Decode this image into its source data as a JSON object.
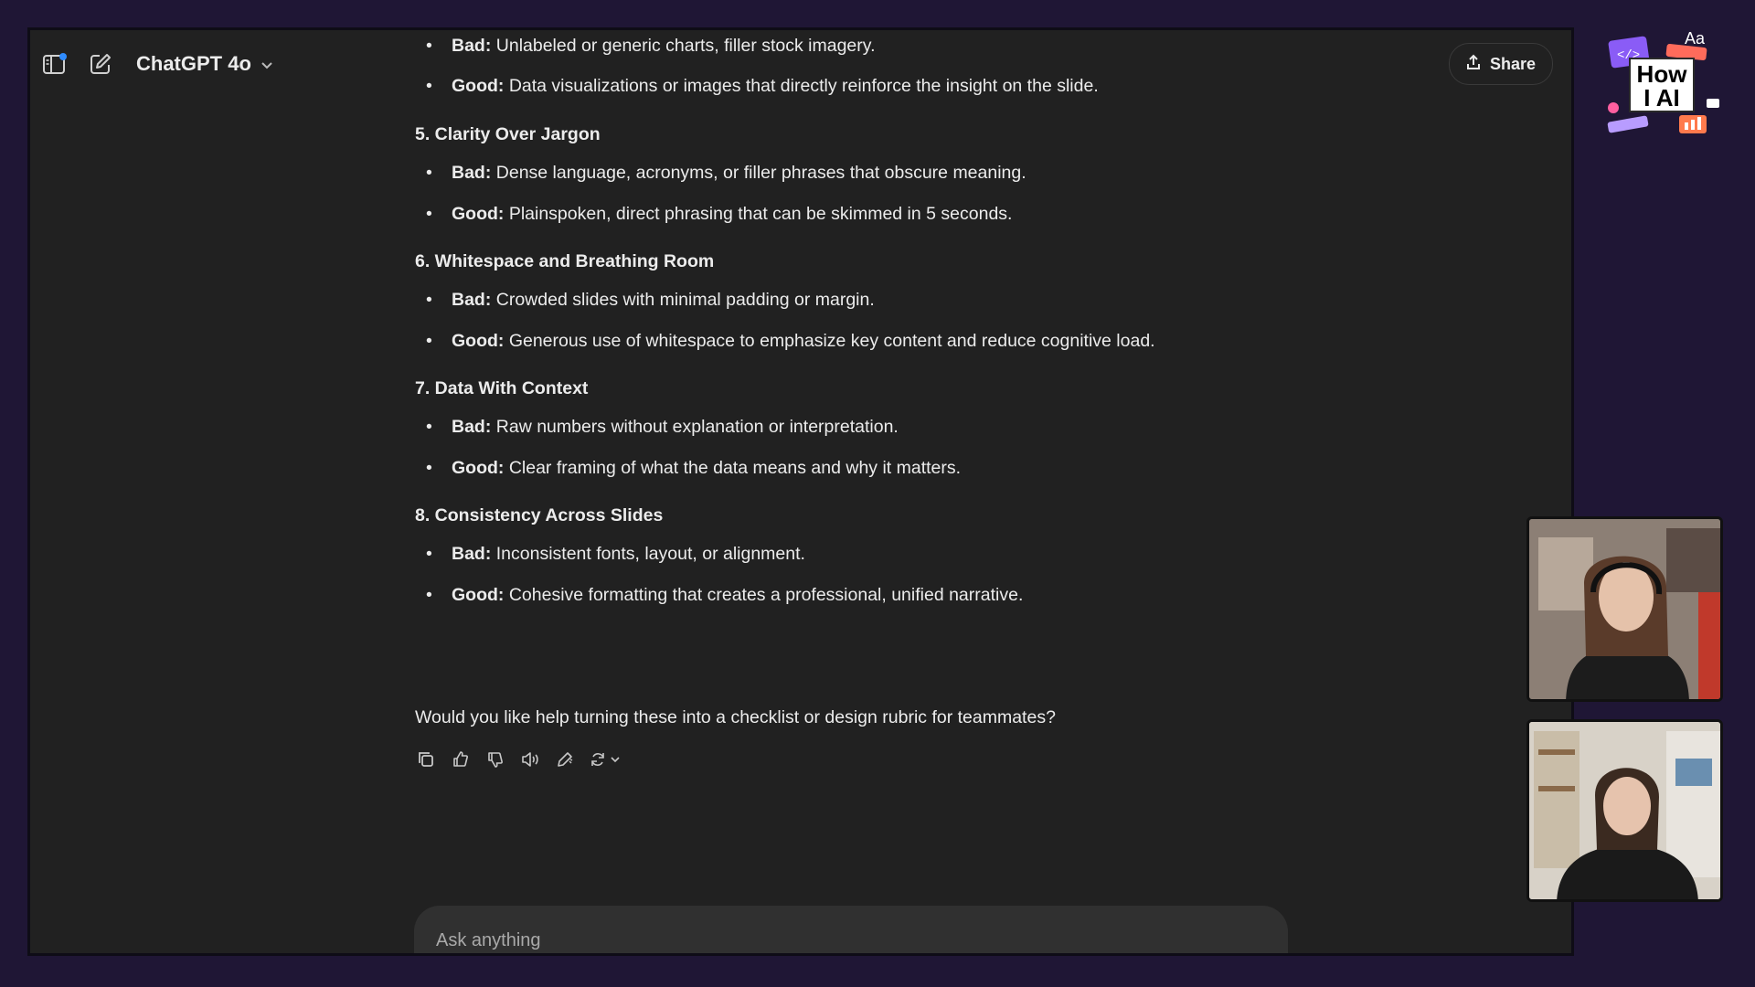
{
  "header": {
    "model_label": "ChatGPT 4o",
    "share_label": "Share"
  },
  "sections": [
    {
      "title": "",
      "items": [
        {
          "label": "Bad:",
          "text": " Unlabeled or generic charts, filler stock imagery."
        },
        {
          "label": "Good:",
          "text": " Data visualizations or images that directly reinforce the insight on the slide."
        }
      ]
    },
    {
      "title": "5. Clarity Over Jargon",
      "items": [
        {
          "label": "Bad:",
          "text": " Dense language, acronyms, or filler phrases that obscure meaning."
        },
        {
          "label": "Good:",
          "text": " Plainspoken, direct phrasing that can be skimmed in 5 seconds."
        }
      ]
    },
    {
      "title": "6. Whitespace and Breathing Room",
      "items": [
        {
          "label": "Bad:",
          "text": " Crowded slides with minimal padding or margin."
        },
        {
          "label": "Good:",
          "text": " Generous use of whitespace to emphasize key content and reduce cognitive load."
        }
      ]
    },
    {
      "title": "7. Data With Context",
      "items": [
        {
          "label": "Bad:",
          "text": " Raw numbers without explanation or interpretation."
        },
        {
          "label": "Good:",
          "text": " Clear framing of what the data means and why it matters."
        }
      ]
    },
    {
      "title": "8. Consistency Across Slides",
      "items": [
        {
          "label": "Bad:",
          "text": " Inconsistent fonts, layout, or alignment."
        },
        {
          "label": "Good:",
          "text": " Cohesive formatting that creates a professional, unified narrative."
        }
      ]
    }
  ],
  "question": "Would you like help turning these into a checklist or design rubric for teammates?",
  "composer": {
    "placeholder": "Ask anything"
  },
  "overlay": {
    "logo_text_line1": "How",
    "logo_text_line2": "I AI",
    "logo_aa": "Aa"
  },
  "colors": {
    "page_bg": "#1f1635",
    "window_bg": "#212121",
    "text": "#ececec",
    "composer_bg": "#303030",
    "accent_blue": "#2f8cff"
  }
}
